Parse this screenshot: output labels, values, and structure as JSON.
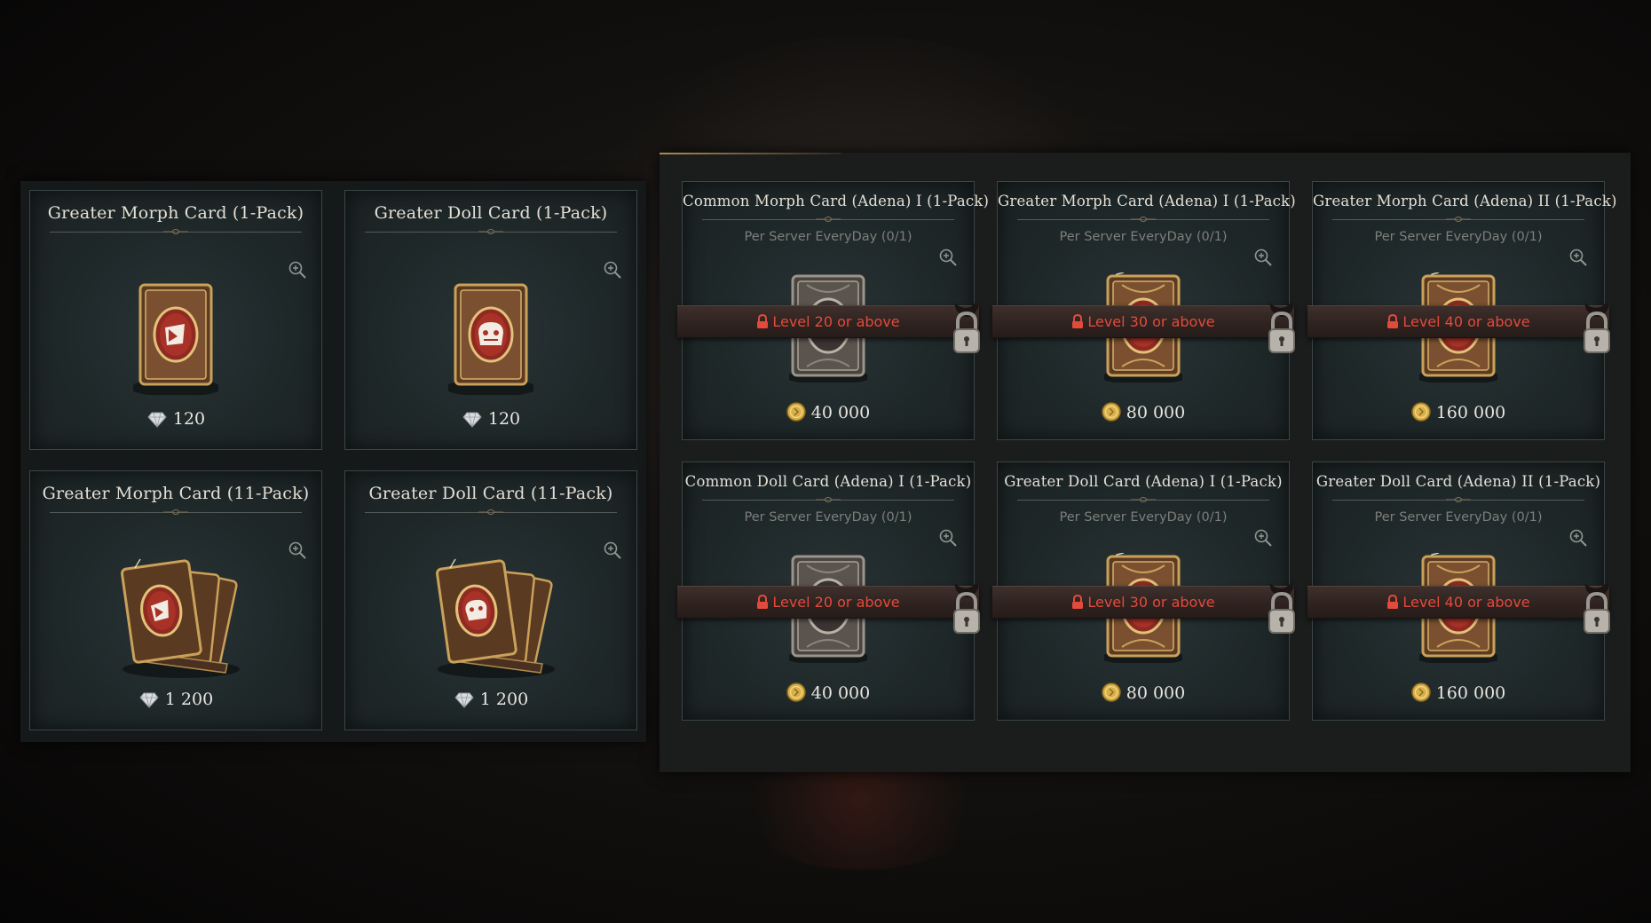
{
  "left_shop": {
    "items": [
      {
        "title": "Greater Morph Card (1-Pack)",
        "price": "120",
        "currency": "diamond-icon",
        "art": "morph-single"
      },
      {
        "title": "Greater Doll Card (1-Pack)",
        "price": "120",
        "currency": "diamond-icon",
        "art": "doll-single"
      },
      {
        "title": "Greater Morph Card (11-Pack)",
        "price": "1 200",
        "currency": "diamond-icon",
        "art": "morph-pack"
      },
      {
        "title": "Greater Doll Card (11-Pack)",
        "price": "1 200",
        "currency": "diamond-icon",
        "art": "doll-pack"
      }
    ]
  },
  "right_shop": {
    "items": [
      {
        "title": "Common Morph Card (Adena) I (1-Pack)",
        "limit": "Per Server EveryDay (0/1)",
        "lock": "Level 20 or above",
        "price": "40 000",
        "currency": "adena-coin-icon",
        "tier": "common"
      },
      {
        "title": "Greater Morph Card (Adena) I (1-Pack)",
        "limit": "Per Server EveryDay (0/1)",
        "lock": "Level 30 or above",
        "price": "80 000",
        "currency": "adena-coin-icon",
        "tier": "greater"
      },
      {
        "title": "Greater Morph Card (Adena) II (1-Pack)",
        "limit": "Per Server EveryDay (0/1)",
        "lock": "Level 40 or above",
        "price": "160 000",
        "currency": "adena-coin-icon",
        "tier": "greater"
      },
      {
        "title": "Common Doll Card (Adena) I (1-Pack)",
        "limit": "Per Server EveryDay (0/1)",
        "lock": "Level 20 or above",
        "price": "40 000",
        "currency": "adena-coin-icon",
        "tier": "common"
      },
      {
        "title": "Greater Doll Card (Adena) I (1-Pack)",
        "limit": "Per Server EveryDay (0/1)",
        "lock": "Level 30 or above",
        "price": "80 000",
        "currency": "adena-coin-icon",
        "tier": "greater"
      },
      {
        "title": "Greater Doll Card (Adena) II (1-Pack)",
        "limit": "Per Server EveryDay (0/1)",
        "lock": "Level 40 or above",
        "price": "160 000",
        "currency": "adena-coin-icon",
        "tier": "greater"
      }
    ]
  },
  "colors": {
    "lock_text": "#e24a3c",
    "title_text": "#e4dfd5",
    "card_bg": "#232c2d",
    "gold": "#d8b04a"
  }
}
